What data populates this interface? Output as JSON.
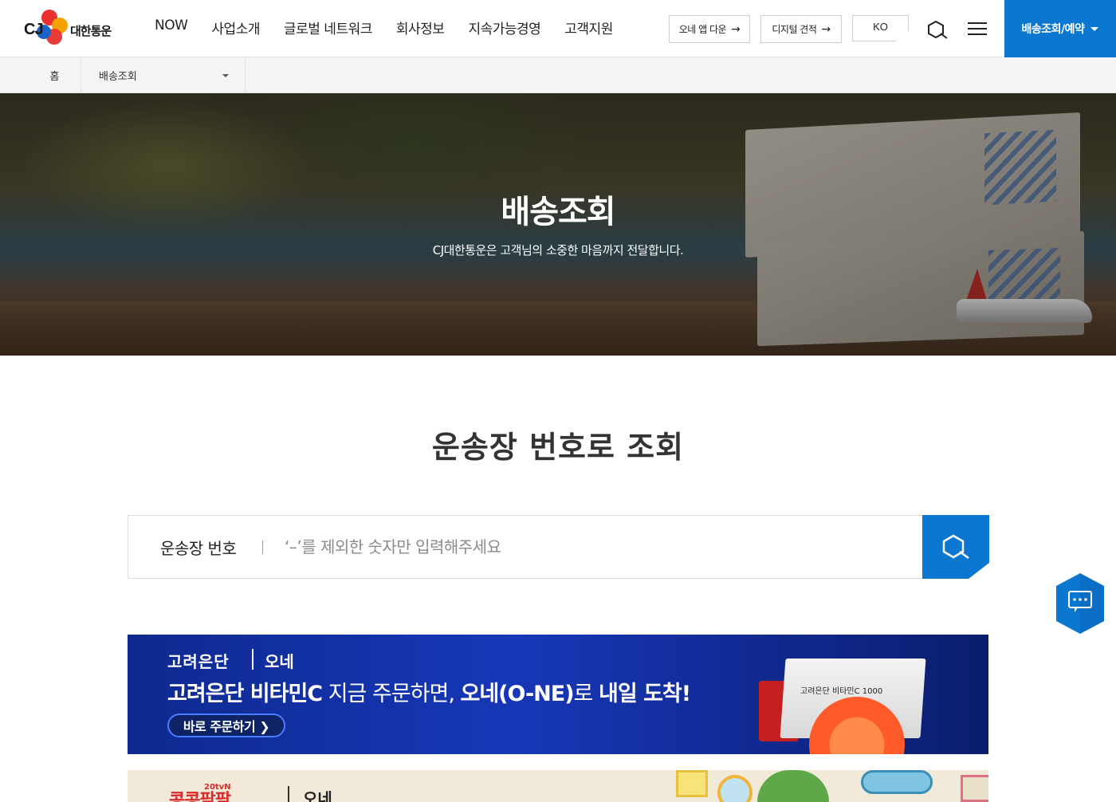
{
  "header": {
    "logo_cj": "CJ",
    "logo_name": "대한통운",
    "nav": [
      "NOW",
      "사업소개",
      "글로벌 네트워크",
      "회사정보",
      "지속가능경영",
      "고객지원"
    ],
    "app_download_label": "오네 앱 다운",
    "digital_quote_label": "디지털 견적",
    "language_label": "KO",
    "track_reserve_label": "배송조회/예약",
    "colors": {
      "accent": "#0b77d0"
    }
  },
  "breadcrumb": {
    "home_label": "홈",
    "current_label": "배송조회"
  },
  "hero": {
    "title": "배송조회",
    "subtitle": "CJ대한통운은 고객님의 소중한 마음까지 전달합니다."
  },
  "search": {
    "section_title": "운송장 번호로 조회",
    "label": "운송장 번호",
    "placeholder": "‘–’를 제외한 숫자만 입력해주세요",
    "value": ""
  },
  "banners": [
    {
      "brand": "고려은단",
      "partner": "오네",
      "headline_bold_1": "고려은단 비타민C",
      "headline_mid": " 지금 주문하면, ",
      "headline_bold_2": "오네(O-NE)",
      "headline_mid_2": "로 ",
      "headline_bold_3": "내일 도착!",
      "cta": "바로 주문하기 ❯",
      "product_label": "고려은단 비타민C 1000"
    },
    {
      "logo": "20tvN",
      "title_fragment": "콩콩팥팥",
      "partner": "오네"
    }
  ],
  "icons": [
    "search-icon",
    "menu-icon",
    "arrow-right-icon",
    "chevron-down-icon",
    "chat-icon"
  ]
}
